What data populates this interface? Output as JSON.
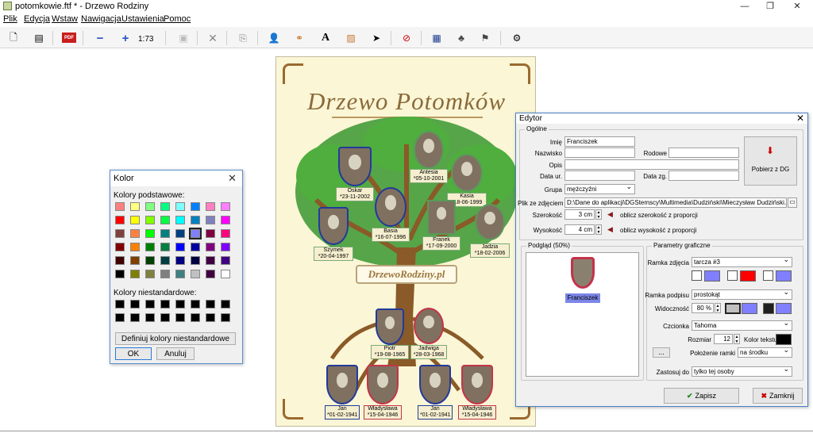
{
  "window": {
    "title": "potomkowie.ftf * - Drzewo Rodziny"
  },
  "menu": [
    "Plik",
    "Edycja",
    "Wstaw",
    "Nawigacja",
    "Ustawienia",
    "Pomoc"
  ],
  "toolbar": {
    "zoom": "1:73"
  },
  "tree": {
    "title": "Drzewo Potomków",
    "brand": "DrzewoRodziny.pl",
    "people": [
      {
        "name": "Oskar",
        "date": "*23-11-2002"
      },
      {
        "name": "Antesia",
        "date": "*05-10-2001"
      },
      {
        "name": "Kasia",
        "date": "*18-06-1999"
      },
      {
        "name": "Basia",
        "date": "*16-07-1996"
      },
      {
        "name": "Szymek",
        "date": "*20-04-1997"
      },
      {
        "name": "Franek",
        "date": "*17-09-2000"
      },
      {
        "name": "Jadzia",
        "date": "*18-02-2006"
      },
      {
        "name": "Piotr",
        "date": "*19-08-1965"
      },
      {
        "name": "Jadwiga",
        "date": "*28-03-1968"
      },
      {
        "name": "Jan",
        "date": "*01-02-1941"
      },
      {
        "name": "Władysława",
        "date": "*15-04-1946"
      },
      {
        "name": "Jan",
        "date": "*01-02-1941"
      },
      {
        "name": "Władysława",
        "date": "*15-04-1946"
      }
    ]
  },
  "kolor": {
    "title": "Kolor",
    "basic_label": "Kolory podstawowe:",
    "custom_label": "Kolory niestandardowe:",
    "define_button": "Definiuj kolory niestandardowe >>",
    "ok": "OK",
    "cancel": "Anuluj",
    "basic_colors": [
      "#ff8080",
      "#ffff80",
      "#80ff80",
      "#00ff80",
      "#80ffff",
      "#0080ff",
      "#ff80c0",
      "#ff80ff",
      "#ff0000",
      "#ffff00",
      "#80ff00",
      "#00ff40",
      "#00ffff",
      "#0080c0",
      "#8080c0",
      "#ff00ff",
      "#804040",
      "#ff8040",
      "#00ff00",
      "#008080",
      "#004080",
      "#8080ff",
      "#800040",
      "#ff0080",
      "#800000",
      "#ff8000",
      "#008000",
      "#008040",
      "#0000ff",
      "#0000a0",
      "#800080",
      "#8000ff",
      "#400000",
      "#804000",
      "#004000",
      "#004040",
      "#000080",
      "#000040",
      "#400040",
      "#400080",
      "#000000",
      "#808000",
      "#808040",
      "#808080",
      "#408080",
      "#c0c0c0",
      "#400040",
      "#ffffff"
    ],
    "custom_colors": [
      "#000000",
      "#000000",
      "#000000",
      "#000000",
      "#000000",
      "#000000",
      "#000000",
      "#000000",
      "#000000",
      "#000000",
      "#000000",
      "#000000",
      "#000000",
      "#000000",
      "#000000",
      "#000000"
    ]
  },
  "editor": {
    "title": "Edytor",
    "ogolne": "Ogólne",
    "imie_label": "Imię",
    "imie": "Franciszek",
    "nazwisko_label": "Nazwisko",
    "nazwisko": "",
    "rodowe_label": "Rodowe",
    "rodowe": "",
    "opis_label": "Opis",
    "opis": "",
    "data_ur_label": "Data ur.",
    "data_ur": "",
    "data_zg_label": "Data zg.",
    "data_zg": "",
    "grupa_label": "Grupa",
    "grupa": "mężczyźni",
    "plik_label": "Plik ze zdjęciem",
    "plik": "D:\\Dane do aplikacji\\DGStemscy\\Multimedia\\Dudziński\\Mieczysław Dudziński.JPG",
    "szerokosc_label": "Szerokość",
    "szerokosc": "3 cm",
    "szer_hint": "oblicz szerokość z proporcji",
    "wysokosc_label": "Wysokość",
    "wysokosc": "4 cm",
    "wys_hint": "oblicz wysokość z proporcji",
    "pobierz": "Pobierz z DG",
    "podglad": "Podgląd (50%)",
    "preview_name": "Franciszek",
    "param_label": "Parametry graficzne",
    "ramka_zdjecia_label": "Ramka zdjęcia",
    "ramka_zdjecia": "tarcza #3",
    "ramka_podpisu_label": "Ramka podpisu",
    "ramka_podpisu": "prostokąt",
    "widocznosc_label": "Widoczność",
    "widocznosc": "80 %",
    "czcionka_label": "Czcionka",
    "czcionka": "Tahoma",
    "rozmiar_label": "Rozmiar",
    "rozmiar": "12",
    "kolor_tekstu_label": "Kolor tekstu",
    "polozenie_label": "Położenie ramki",
    "polozenie": "na środku",
    "more": "...",
    "zastosuj_label": "Zastosuj do",
    "zastosuj": "tylko tej osoby",
    "zapisz": "Zapisz",
    "zamknij": "Zamknij",
    "colors": {
      "photo_frame_1": "#ffffff",
      "photo_frame_2": "#8080ff",
      "photo_frame_3": "#ffffff",
      "photo_frame_4": "#ff0000",
      "photo_frame_5": "#ffffff",
      "photo_frame_6": "#8080ff",
      "caption_1": "#c0c0c0",
      "caption_2": "#8080ff",
      "caption_3": "#202020",
      "caption_4": "#8080ff",
      "text": "#000000"
    }
  }
}
